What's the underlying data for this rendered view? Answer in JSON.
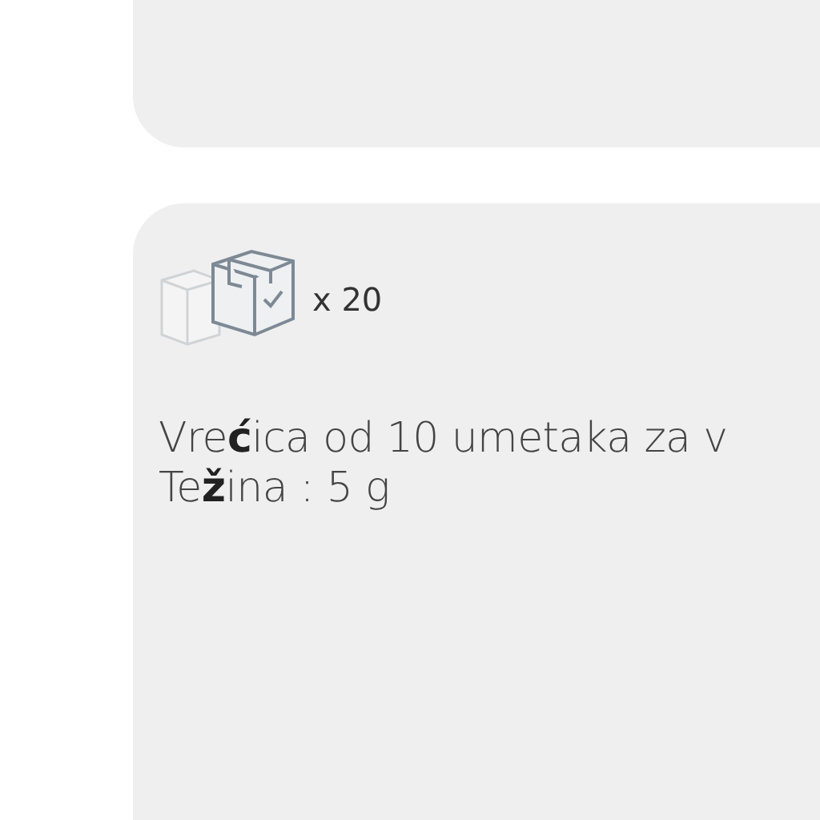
{
  "product_card": {
    "quantity": "x 20",
    "description": [
      "Vre**ć**ica od 10 umetaka za v",
      "Te**ž**ina : 5 g"
    ]
  }
}
